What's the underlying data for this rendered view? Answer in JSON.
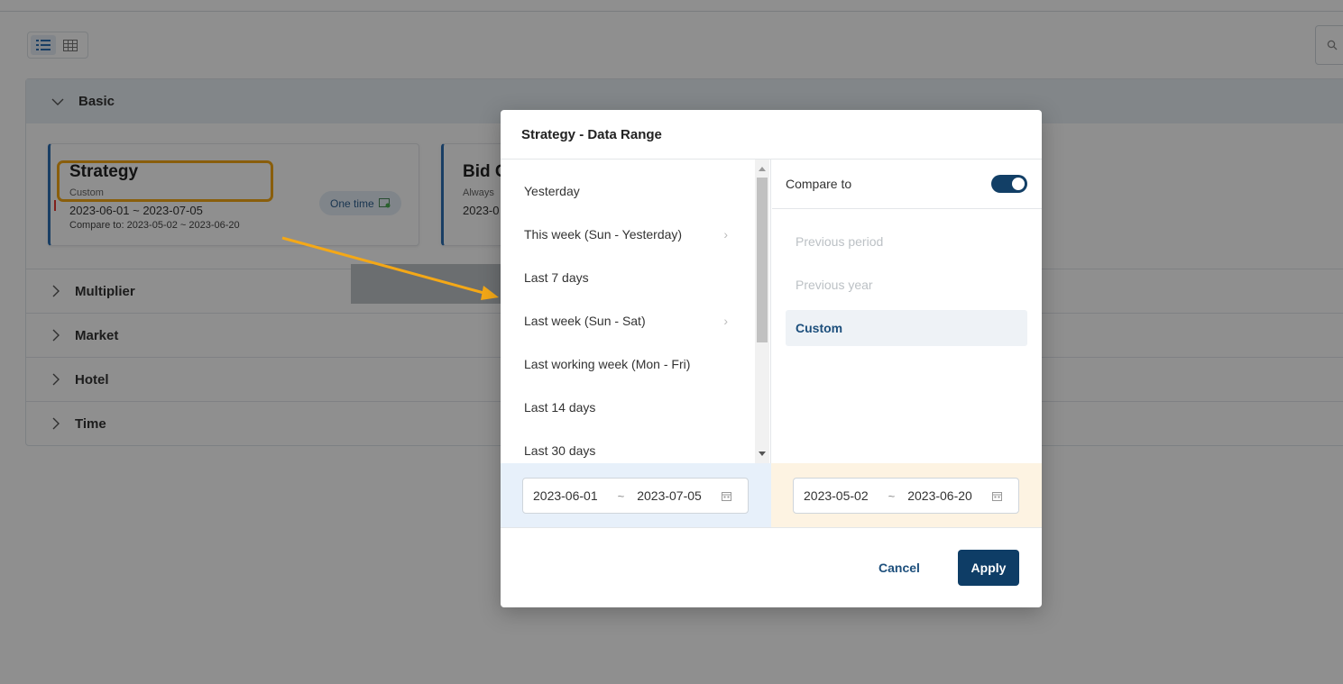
{
  "page": {
    "sections": [
      {
        "label": "Basic"
      },
      {
        "label": "Multiplier"
      },
      {
        "label": "Market"
      },
      {
        "label": "Hotel"
      },
      {
        "label": "Time"
      }
    ],
    "cards": {
      "strategy": {
        "title": "Strategy",
        "subtitle": "Custom",
        "range": "2023-06-01 ~ 2023-07-05",
        "compare": "Compare to: 2023-05-02 ~ 2023-06-20",
        "badge": "One time"
      },
      "bid": {
        "title": "Bid C",
        "subtitle": "Always",
        "range": "2023-0"
      }
    }
  },
  "modal": {
    "title": "Strategy - Data Range",
    "presets": [
      {
        "label": "Yesterday",
        "has_submenu": false
      },
      {
        "label": "This week (Sun - Yesterday)",
        "has_submenu": true
      },
      {
        "label": "Last 7 days",
        "has_submenu": false
      },
      {
        "label": "Last week (Sun - Sat)",
        "has_submenu": true
      },
      {
        "label": "Last working week (Mon - Fri)",
        "has_submenu": false
      },
      {
        "label": "Last 14 days",
        "has_submenu": false
      },
      {
        "label": "Last 30 days",
        "has_submenu": false
      }
    ],
    "compare_label": "Compare to",
    "compare_enabled": true,
    "compare_options": [
      {
        "label": "Previous period",
        "selected": false
      },
      {
        "label": "Previous year",
        "selected": false
      },
      {
        "label": "Custom",
        "selected": true
      }
    ],
    "primary_range": {
      "start": "2023-06-01",
      "separator": "~",
      "end": "2023-07-05"
    },
    "compare_range": {
      "start": "2023-05-02",
      "separator": "~",
      "end": "2023-06-20"
    },
    "cancel_label": "Cancel",
    "apply_label": "Apply"
  },
  "colors": {
    "accent": "#0e3d66",
    "highlight": "#f4a817",
    "toggle_on": "#123f66"
  }
}
